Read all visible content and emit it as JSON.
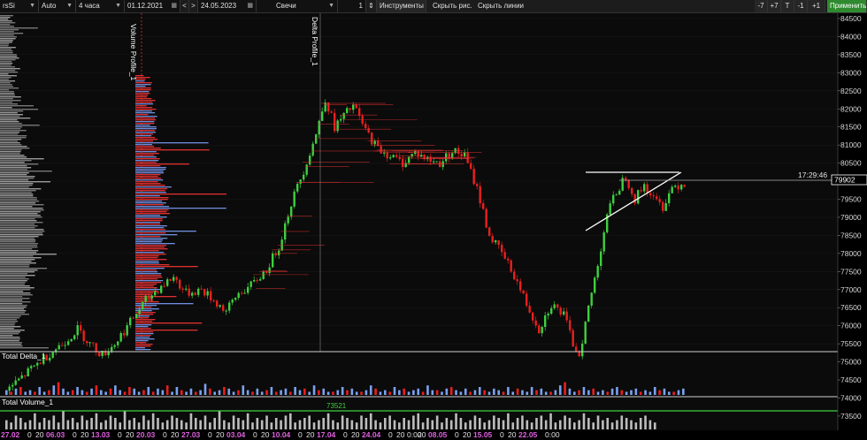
{
  "toolbar": {
    "symbol": "rsSi",
    "scale": "Auto",
    "timeframe": "4 часа",
    "date_from": "01.12.2021",
    "nav_prev": "<",
    "nav_next": ">",
    "date_to": "24.05.2023",
    "chart_type": "Свечи",
    "multiplier": "1",
    "tools_label": "Инструменты",
    "hide_drawings": "Скрыть рис.",
    "hide_lines": "Скрыть линии",
    "btn_m7": "-7",
    "btn_p7": "+7",
    "btn_t": "T",
    "btn_m1": "-1",
    "btn_p1": "+1",
    "apply": "Применить"
  },
  "colors": {
    "bull": "#3fcf3f",
    "bear": "#e8201e",
    "profile_blue": "#6f8fe0",
    "profile_red": "#e03030",
    "delta_blue": "#7aa2f0",
    "volume_gray": "#bdbdbd",
    "level_green": "#3fcf3f"
  },
  "price_axis": {
    "ticks": [
      "84500",
      "84000",
      "83500",
      "83000",
      "82500",
      "82000",
      "81500",
      "81000",
      "80500",
      "80000",
      "79500",
      "79000",
      "78500",
      "78000",
      "77500",
      "77000",
      "76500",
      "76000",
      "75500",
      "75000",
      "74500",
      "74000",
      "73500"
    ],
    "current_price": "79902",
    "timer": "17:29:46"
  },
  "studies": {
    "volume_profile": "Volume Profile_1",
    "delta_profile": "Delta Profile_1",
    "total_delta": "Total Delta_1",
    "total_volume": "Total Volume_1",
    "volume_value": "73521"
  },
  "time_axis": [
    {
      "label": "27.02",
      "date": true
    },
    {
      "label": "0",
      "date": false
    },
    {
      "label": "20",
      "date": false
    },
    {
      "label": "06.03",
      "date": true
    },
    {
      "label": "0",
      "date": false
    },
    {
      "label": "20",
      "date": false
    },
    {
      "label": "13.03",
      "date": true
    },
    {
      "label": "0",
      "date": false
    },
    {
      "label": "20",
      "date": false
    },
    {
      "label": "20.03",
      "date": true
    },
    {
      "label": "0",
      "date": false
    },
    {
      "label": "20",
      "date": false
    },
    {
      "label": "27.03",
      "date": true
    },
    {
      "label": "0",
      "date": false
    },
    {
      "label": "20",
      "date": false
    },
    {
      "label": "03.04",
      "date": true
    },
    {
      "label": "0",
      "date": false
    },
    {
      "label": "20",
      "date": false
    },
    {
      "label": "10.04",
      "date": true
    },
    {
      "label": "0",
      "date": false
    },
    {
      "label": "20",
      "date": false
    },
    {
      "label": "17.04",
      "date": true
    },
    {
      "label": "0",
      "date": false
    },
    {
      "label": "20",
      "date": false
    },
    {
      "label": "24.04",
      "date": true
    },
    {
      "label": "0",
      "date": false
    },
    {
      "label": "20",
      "date": false
    },
    {
      "label": "0:00",
      "date": false
    },
    {
      "label": "20",
      "date": false
    },
    {
      "label": "08.05",
      "date": true
    },
    {
      "label": "0",
      "date": false
    },
    {
      "label": "20",
      "date": false
    },
    {
      "label": "15.05",
      "date": true
    },
    {
      "label": "0",
      "date": false
    },
    {
      "label": "20",
      "date": false
    },
    {
      "label": "22.05",
      "date": true
    },
    {
      "label": "0:00",
      "date": false
    }
  ],
  "chart_data": {
    "type": "candlestick",
    "price_range": [
      73300,
      84700
    ],
    "close_path": [
      [
        0,
        74200
      ],
      [
        6,
        74650
      ],
      [
        12,
        75100
      ],
      [
        18,
        75500
      ],
      [
        23,
        75900
      ],
      [
        27,
        75500
      ],
      [
        31,
        75200
      ],
      [
        35,
        75500
      ],
      [
        40,
        76100
      ],
      [
        45,
        76700
      ],
      [
        50,
        77100
      ],
      [
        54,
        77350
      ],
      [
        58,
        76900
      ],
      [
        63,
        77000
      ],
      [
        67,
        76700
      ],
      [
        71,
        76400
      ],
      [
        75,
        76900
      ],
      [
        79,
        77100
      ],
      [
        84,
        77550
      ],
      [
        88,
        78200
      ],
      [
        92,
        79400
      ],
      [
        96,
        80300
      ],
      [
        100,
        81300
      ],
      [
        103,
        82300
      ],
      [
        106,
        81500
      ],
      [
        109,
        81800
      ],
      [
        112,
        82100
      ],
      [
        116,
        81400
      ],
      [
        120,
        80900
      ],
      [
        124,
        80700
      ],
      [
        128,
        80500
      ],
      [
        132,
        80800
      ],
      [
        136,
        80600
      ],
      [
        140,
        80500
      ],
      [
        144,
        80850
      ],
      [
        148,
        80700
      ],
      [
        152,
        79800
      ],
      [
        156,
        78500
      ],
      [
        160,
        78000
      ],
      [
        164,
        77400
      ],
      [
        168,
        76600
      ],
      [
        172,
        75900
      ],
      [
        176,
        76600
      ],
      [
        180,
        76300
      ],
      [
        183,
        75500
      ],
      [
        185,
        75200
      ],
      [
        188,
        76500
      ],
      [
        191,
        77700
      ],
      [
        194,
        79100
      ],
      [
        197,
        79700
      ],
      [
        200,
        80150
      ],
      [
        203,
        79500
      ],
      [
        206,
        79900
      ],
      [
        209,
        79500
      ],
      [
        212,
        79300
      ],
      [
        215,
        79850
      ],
      [
        219,
        79950
      ]
    ],
    "overlay_bars": [
      80,
      140
    ],
    "delta_values": [
      3,
      -2,
      4,
      -5,
      2,
      3,
      -2,
      5,
      2,
      -3,
      6,
      -8,
      4,
      2,
      -3,
      5,
      3,
      -2,
      4,
      -6,
      3,
      2,
      -4,
      6,
      3,
      -2,
      -5,
      4,
      2,
      -3,
      5,
      -2,
      4,
      3,
      -6,
      2,
      5,
      -3,
      2,
      4,
      -2,
      3,
      7,
      -4,
      2,
      3,
      -5,
      4,
      2,
      -3,
      6,
      3,
      -2,
      4,
      2,
      -3,
      5,
      -2,
      3,
      4,
      -2,
      5,
      3,
      -4,
      2,
      6,
      -3,
      4,
      2,
      -2,
      3,
      5,
      -3,
      4,
      2,
      -2,
      3,
      6,
      -4,
      2,
      3,
      -2,
      5,
      3,
      -4,
      2,
      3,
      4,
      -2,
      6,
      3,
      -3,
      2,
      4,
      -5,
      3,
      2,
      4,
      -2,
      3,
      5,
      -3,
      2,
      4,
      3,
      -2,
      5,
      2,
      -4,
      3,
      2,
      5,
      -3,
      4,
      2,
      -2,
      3,
      6,
      -8,
      4,
      2,
      -3,
      5,
      3,
      -4,
      2,
      3,
      -2,
      4,
      5,
      -3,
      2,
      3,
      4,
      -2,
      3,
      2,
      5,
      -3,
      4,
      2,
      -2,
      3,
      4
    ],
    "volume_values": [
      4,
      3,
      6,
      5,
      3,
      4,
      7,
      3,
      5,
      4,
      6,
      3,
      8,
      4,
      5,
      3,
      6,
      4,
      5,
      7,
      3,
      4,
      6,
      5,
      3,
      8,
      4,
      5,
      3,
      6,
      4,
      7,
      5,
      3,
      4,
      6,
      5,
      4,
      3,
      7,
      5,
      4,
      6,
      3,
      5,
      8,
      4,
      3,
      6,
      5,
      4,
      7,
      3,
      5,
      4,
      6,
      3,
      5,
      4,
      6,
      7,
      3,
      4,
      5,
      6,
      3,
      4,
      5,
      7,
      4,
      3,
      6,
      5,
      4,
      3,
      6,
      5,
      7,
      4,
      3,
      5,
      6,
      4,
      3,
      5,
      4,
      6,
      7,
      3,
      5,
      4,
      6,
      3,
      5,
      4,
      7,
      5,
      3,
      4,
      6,
      5,
      3,
      4,
      6,
      5,
      4,
      7,
      3,
      5,
      6,
      4,
      3,
      5,
      6,
      4,
      7,
      3,
      4,
      6,
      5,
      3,
      4,
      7,
      5,
      3,
      6,
      4,
      5,
      3,
      4,
      6,
      5,
      4,
      3,
      5,
      6,
      4,
      3
    ]
  }
}
